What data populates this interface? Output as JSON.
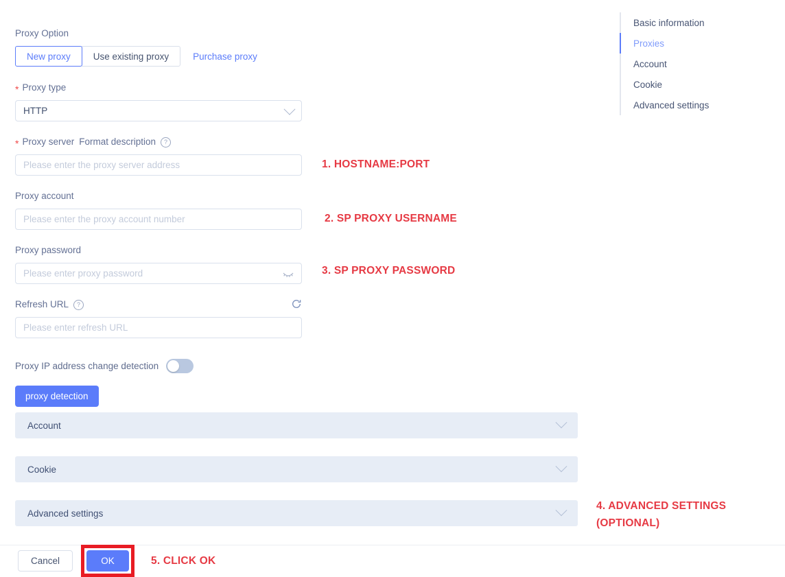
{
  "form": {
    "proxy_option": {
      "label": "Proxy Option",
      "tabs": [
        {
          "label": "New proxy",
          "active": true
        },
        {
          "label": "Use existing proxy",
          "active": false
        }
      ],
      "link": "Purchase proxy"
    },
    "proxy_type": {
      "label": "Proxy type",
      "required": true,
      "value": "HTTP",
      "icon": "chevron-down-icon"
    },
    "proxy_server": {
      "label": "Proxy server",
      "link_label": "Format description",
      "required": true,
      "help_icon": "question-circle-icon",
      "placeholder": "Please enter the proxy server address",
      "value": ""
    },
    "proxy_account": {
      "label": "Proxy account",
      "placeholder": "Please enter the proxy account number",
      "value": ""
    },
    "proxy_password": {
      "label": "Proxy password",
      "placeholder": "Please enter proxy password",
      "value": "",
      "icon": "eye-off-icon"
    },
    "refresh_url": {
      "label": "Refresh URL",
      "help_icon": "question-circle-icon",
      "refresh_icon": "refresh-icon",
      "placeholder": "Please enter refresh URL",
      "value": ""
    },
    "ip_change_detection": {
      "label": "Proxy IP address change detection",
      "state": "off"
    },
    "detection_button": {
      "label": "proxy detection"
    }
  },
  "panels": [
    {
      "title": "Account",
      "icon": "chevron-down-icon"
    },
    {
      "title": "Cookie",
      "icon": "chevron-down-icon"
    },
    {
      "title": "Advanced settings",
      "icon": "chevron-down-icon"
    }
  ],
  "anchor_nav": {
    "items": [
      {
        "label": "Basic information",
        "active": false
      },
      {
        "label": "Proxies",
        "active": true
      },
      {
        "label": "Account",
        "active": false
      },
      {
        "label": "Cookie",
        "active": false
      },
      {
        "label": "Advanced settings",
        "active": false
      }
    ]
  },
  "annotations": [
    {
      "id": 1,
      "text": "1. HOSTNAME:PORT"
    },
    {
      "id": 2,
      "text": "2. SP PROXY USERNAME"
    },
    {
      "id": 3,
      "text": "3. SP PROXY PASSWORD"
    },
    {
      "id": 4,
      "text": "4. ADVANCED SETTINGS (OPTIONAL)"
    },
    {
      "id": 5,
      "text": "5. CLICK OK"
    }
  ],
  "footer": {
    "cancel_label": "Cancel",
    "ok_label": "OK"
  },
  "colors": {
    "accent_blue": "#5b7cfa",
    "annotation_red": "#e63a44",
    "highlight_red": "#e81c24",
    "panel_bg": "#e7edf6",
    "required_star": "#f04a4a"
  }
}
